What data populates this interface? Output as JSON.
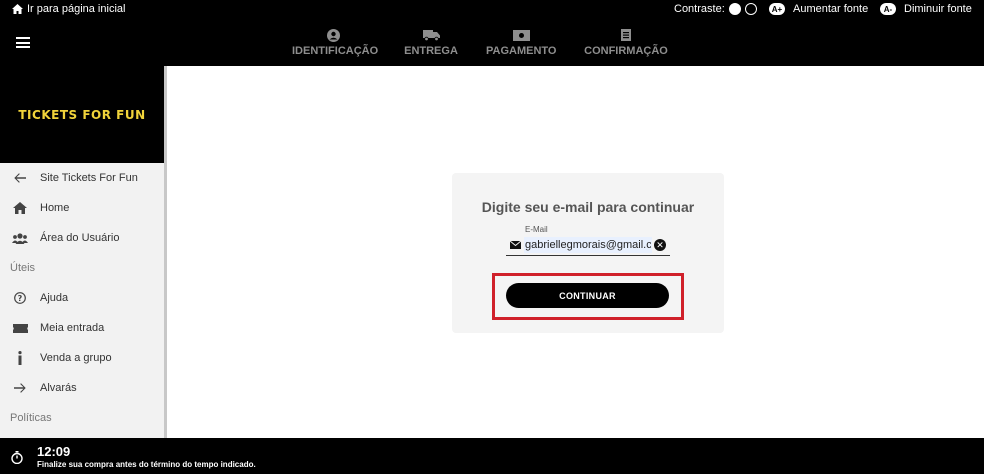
{
  "topbar": {
    "skip_link": "Ir para página inicial",
    "contrast_label": "Contraste:",
    "increase_badge": "A+",
    "increase_label": "Aumentar fonte",
    "decrease_badge": "A-",
    "decrease_label": "Diminuir fonte"
  },
  "steps": [
    {
      "label": "IDENTIFICAÇÃO",
      "icon": "user-icon"
    },
    {
      "label": "ENTREGA",
      "icon": "truck-icon"
    },
    {
      "label": "PAGAMENTO",
      "icon": "money-icon"
    },
    {
      "label": "CONFIRMAÇÃO",
      "icon": "document-icon"
    }
  ],
  "logo": "TICKETS FOR FUN",
  "sidebar": {
    "items": [
      {
        "label": "Site Tickets For Fun",
        "icon": "arrow-left-icon"
      },
      {
        "label": "Home",
        "icon": "home-icon"
      },
      {
        "label": "Área do Usuário",
        "icon": "users-icon"
      }
    ],
    "section_uteis": "Úteis",
    "uteis_items": [
      {
        "label": "Ajuda",
        "icon": "help-icon"
      },
      {
        "label": "Meia entrada",
        "icon": "ticket-icon"
      },
      {
        "label": "Venda a grupo",
        "icon": "info-icon"
      },
      {
        "label": "Alvarás",
        "icon": "arrow-right-icon"
      }
    ],
    "section_politicas": "Políticas"
  },
  "login_card": {
    "title": "Digite seu e-mail para continuar",
    "email_label": "E-Mail",
    "email_value": "gabriellegmorais@gmail.com",
    "continue_button": "CONTINUAR"
  },
  "footer": {
    "time": "12:09",
    "message": "Finalize sua compra antes do término do tempo indicado."
  },
  "colors": {
    "logo": "#f0d33a",
    "highlight": "#d0202a",
    "step_text": "#8e8e8e"
  }
}
